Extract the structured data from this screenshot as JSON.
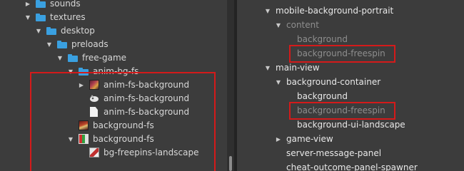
{
  "assets_tree": [
    {
      "label": "sounds",
      "type": "folder",
      "indent": 3,
      "expanded": false
    },
    {
      "label": "textures",
      "type": "folder",
      "indent": 3,
      "expanded": true
    },
    {
      "label": "desktop",
      "type": "folder",
      "indent": 4,
      "expanded": true
    },
    {
      "label": "preloads",
      "type": "folder",
      "indent": 5,
      "expanded": true
    },
    {
      "label": "free-game",
      "type": "folder",
      "indent": 6,
      "expanded": true
    },
    {
      "label": "anim-bg-fs",
      "type": "folder",
      "indent": 7,
      "expanded": true
    },
    {
      "label": "anim-fs-background",
      "type": "anim-texture",
      "indent": 8,
      "expanded": false
    },
    {
      "label": "anim-fs-background",
      "type": "anim-clip",
      "indent": 8
    },
    {
      "label": "anim-fs-background",
      "type": "document",
      "indent": 8
    },
    {
      "label": "background-fs",
      "type": "texture",
      "indent": 7
    },
    {
      "label": "background-fs",
      "type": "atlas",
      "indent": 7,
      "expanded": true
    },
    {
      "label": "bg-freepins-landscape",
      "type": "sprite",
      "indent": 8
    }
  ],
  "node_tree": [
    {
      "label": "mobile-background-portrait",
      "indent": 0,
      "expanded": true,
      "style": "bright"
    },
    {
      "label": "content",
      "indent": 1,
      "expanded": true,
      "style": "dim"
    },
    {
      "label": "background",
      "indent": 2,
      "style": "dim"
    },
    {
      "label": "background-freespin",
      "indent": 2,
      "style": "dim",
      "highlighted": true
    },
    {
      "label": "main-view",
      "indent": 0,
      "expanded": true,
      "style": "bright"
    },
    {
      "label": "background-container",
      "indent": 1,
      "expanded": true,
      "style": "bright"
    },
    {
      "label": "background",
      "indent": 2,
      "style": "bright"
    },
    {
      "label": "background-freespin",
      "indent": 2,
      "style": "dim",
      "highlighted": true
    },
    {
      "label": "background-ui-landscape",
      "indent": 2,
      "style": "bright"
    },
    {
      "label": "game-view",
      "indent": 1,
      "expanded": false,
      "style": "bright"
    },
    {
      "label": "server-message-panel",
      "indent": 1,
      "style": "bright"
    },
    {
      "label": "cheat-outcome-panel-spawner",
      "indent": 1,
      "style": "bright"
    }
  ],
  "colors": {
    "folder": "#3aa0e0",
    "highlight_border": "#d41a1a",
    "panel_bg": "#3c3c3c"
  }
}
